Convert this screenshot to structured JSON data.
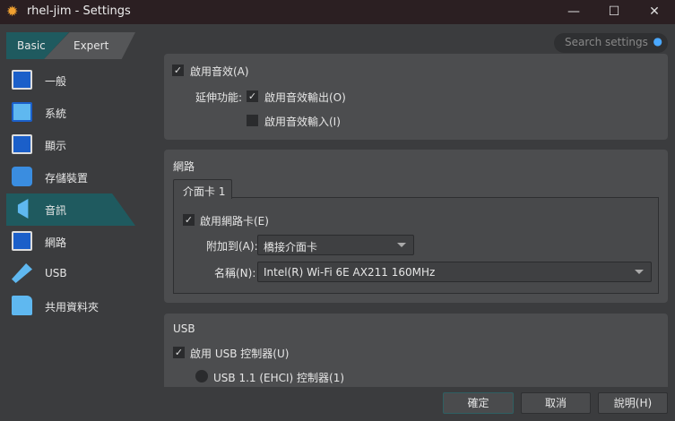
{
  "window": {
    "title": "rhel-jim - Settings",
    "minimize": "—",
    "maximize": "☐",
    "close": "✕"
  },
  "mode_tabs": {
    "basic": "Basic",
    "expert": "Expert"
  },
  "search": {
    "placeholder": "Search settings"
  },
  "sidebar": {
    "items": [
      {
        "label": "一般",
        "icon": "monitor-icon"
      },
      {
        "label": "系統",
        "icon": "chip-icon"
      },
      {
        "label": "顯示",
        "icon": "display-icon"
      },
      {
        "label": "存儲裝置",
        "icon": "disk-icon"
      },
      {
        "label": "音訊",
        "icon": "speaker-icon",
        "selected": true
      },
      {
        "label": "網路",
        "icon": "network-icon"
      },
      {
        "label": "USB",
        "icon": "usb-icon"
      },
      {
        "label": "共用資料夾",
        "icon": "folder-icon"
      }
    ]
  },
  "audio": {
    "enable": "啟用音效(A)",
    "enable_checked": true,
    "ext_label": "延伸功能:",
    "output": "啟用音效輸出(O)",
    "output_checked": true,
    "input": "啟用音效輸入(I)",
    "input_checked": false
  },
  "network": {
    "title": "網路",
    "tab": "介面卡 1",
    "enable": "啟用網路卡(E)",
    "enable_checked": true,
    "attach_label": "附加到(A):",
    "attach_value": "橋接介面卡",
    "name_label": "名稱(N):",
    "name_value": "Intel(R) Wi-Fi 6E AX211 160MHz"
  },
  "usb": {
    "title": "USB",
    "enable": "啟用 USB 控制器(U)",
    "enable_checked": true,
    "option1": "USB 1.1 (EHCI) 控制器(1)"
  },
  "buttons": {
    "ok": "確定",
    "cancel": "取消",
    "help": "說明(H)"
  },
  "colors": {
    "accent": "#1f5a5f",
    "titlebar": "#2b1f22"
  }
}
